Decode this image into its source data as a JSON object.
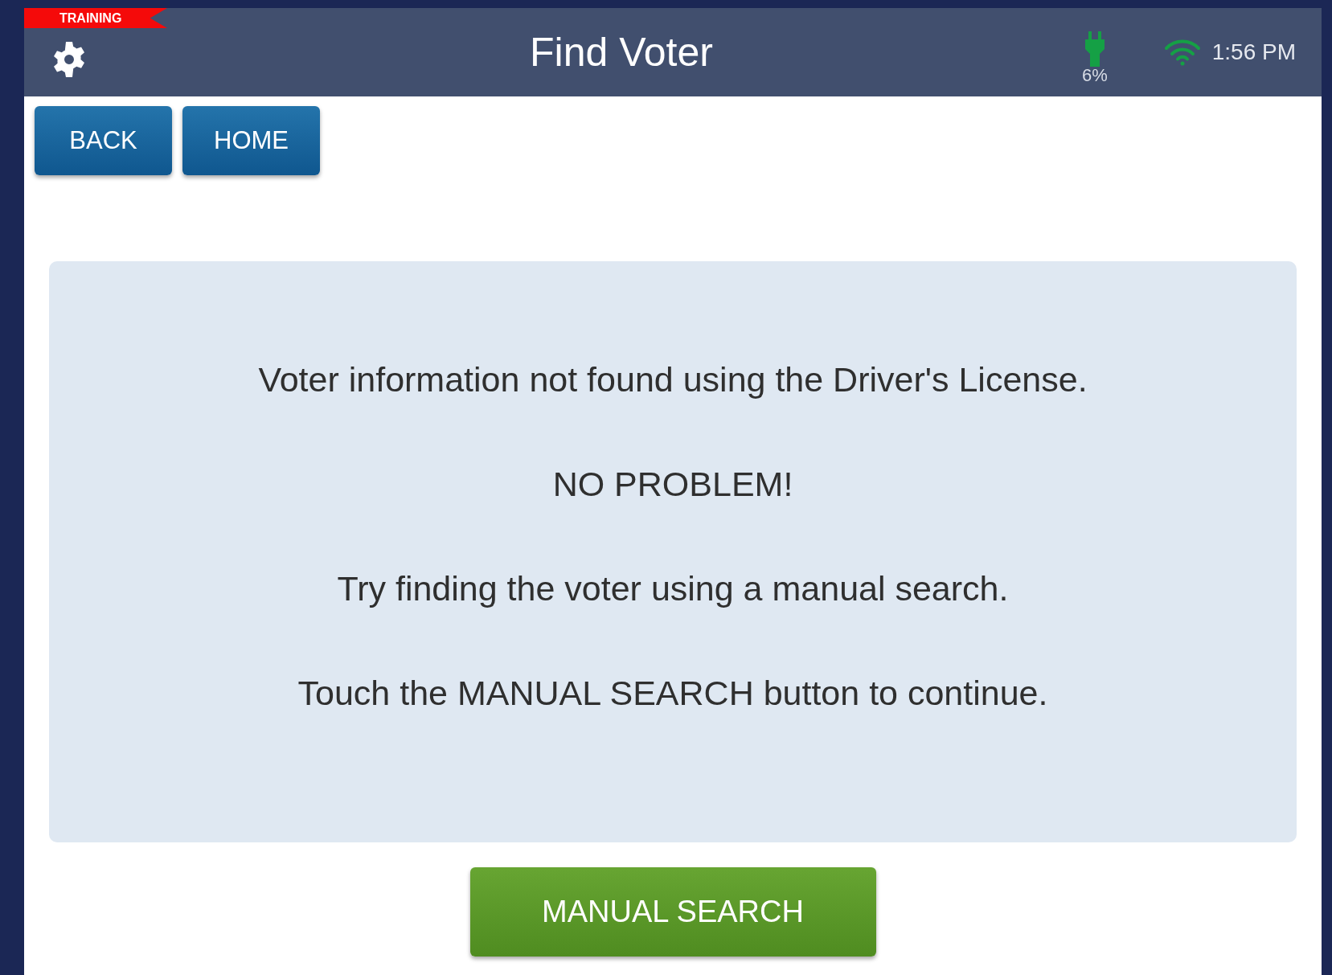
{
  "mode_ribbon": "TRAINING",
  "header": {
    "title": "Find Voter",
    "battery": "6%",
    "time": "1:56 PM"
  },
  "nav_buttons": [
    {
      "label": "BACK"
    },
    {
      "label": "HOME"
    }
  ],
  "message": [
    "Voter information not found using the Driver's License.",
    "NO PROBLEM!",
    "Try finding the voter using a manual search.",
    "Touch the MANUAL SEARCH button to continue."
  ],
  "action_button": "MANUAL SEARCH"
}
